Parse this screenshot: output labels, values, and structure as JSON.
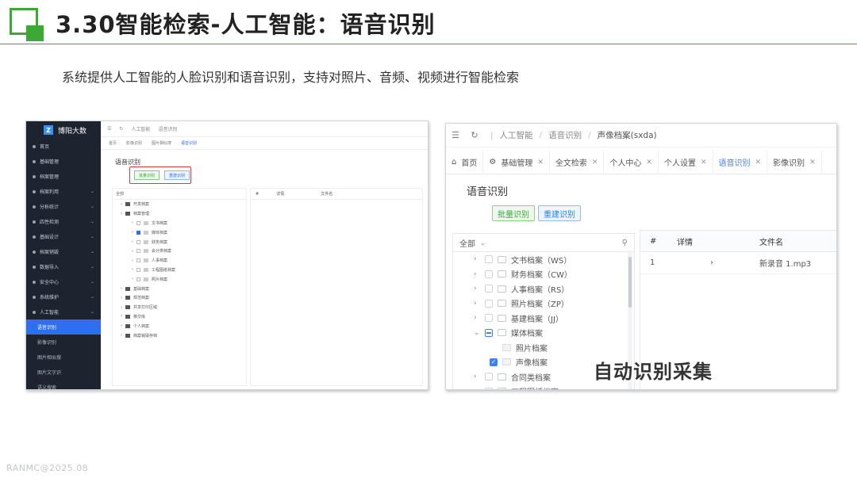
{
  "slide": {
    "title": "3.30智能检索-人工智能：语音识别",
    "subtitle": "系统提供人工智能的人脸识别和语音识别，支持对照片、音频、视频进行智能检索",
    "watermark": "RANMC@2025.08",
    "accent_color": "#3aaa35"
  },
  "left_screenshot": {
    "brand": "博阳大数",
    "sidebar_items": [
      "首页",
      "基础管理",
      "档案管理",
      "档案利用",
      "分析统计",
      "四性检测",
      "基础设计",
      "档案销毁",
      "数据导入",
      "安全中心",
      "系统维护",
      "人工智能"
    ],
    "sidebar_sub_items": [
      "语音识别",
      "影像识别",
      "图片相似搜",
      "图片文字识",
      "语义搜索"
    ],
    "active_sub_item": "语音识别",
    "heading": "语音识别",
    "buttons": [
      "批量识别",
      "重建识别"
    ],
    "tree_header": "全部",
    "tree_rows": [
      "开发档案",
      "档案管理",
      "文书档案",
      "媒体档案",
      "财务档案",
      "会计类档案",
      "人事档案",
      "工程图纸档案",
      "照片档案",
      "基础档案",
      "规范档案",
      "共享打印区域",
      "移交库",
      "个人档案",
      "档案销毁存档"
    ],
    "grid_headers": [
      "#",
      "详情",
      "文件名"
    ]
  },
  "right_screenshot": {
    "breadcrumb": [
      "人工智能",
      "语音识别",
      "声像档案(sxda)"
    ],
    "tabs": [
      {
        "label": "首页",
        "icon": "home-icon",
        "closable": false,
        "active": false
      },
      {
        "label": "基础管理",
        "icon": "gear-icon",
        "closable": true,
        "active": false
      },
      {
        "label": "全文检索",
        "closable": true,
        "active": false
      },
      {
        "label": "个人中心",
        "closable": true,
        "active": false
      },
      {
        "label": "个人设置",
        "closable": true,
        "active": false
      },
      {
        "label": "语音识别",
        "closable": true,
        "active": true
      },
      {
        "label": "影像识别",
        "closable": true,
        "active": false
      }
    ],
    "heading": "语音识别",
    "buttons": {
      "recognize": "批量识别",
      "rebuild": "重建识别"
    },
    "tree_filter": "全部",
    "tree": [
      {
        "label": "文书档案（WS）",
        "state": "unchecked",
        "child": false
      },
      {
        "label": "财务档案（CW）",
        "state": "unchecked",
        "child": false
      },
      {
        "label": "人事档案（RS）",
        "state": "unchecked",
        "child": false
      },
      {
        "label": "照片档案（ZP）",
        "state": "unchecked",
        "child": false
      },
      {
        "label": "基建档案（JJ）",
        "state": "unchecked",
        "child": false
      },
      {
        "label": "媒体档案",
        "state": "partial",
        "child": false,
        "expanded": true
      },
      {
        "label": "照片档案",
        "state": "none",
        "child": true
      },
      {
        "label": "声像档案",
        "state": "checked",
        "child": true
      },
      {
        "label": "合同类档案",
        "state": "unchecked",
        "child": false
      },
      {
        "label": "工程图纸档案",
        "state": "unchecked",
        "child": false
      }
    ],
    "grid": {
      "headers": {
        "num": "#",
        "detail": "详情",
        "filename": "文件名"
      },
      "rows": [
        {
          "num": "1",
          "detail": "›",
          "filename": "新录音 1.mp3"
        }
      ]
    },
    "caption": "自动识别采集"
  }
}
